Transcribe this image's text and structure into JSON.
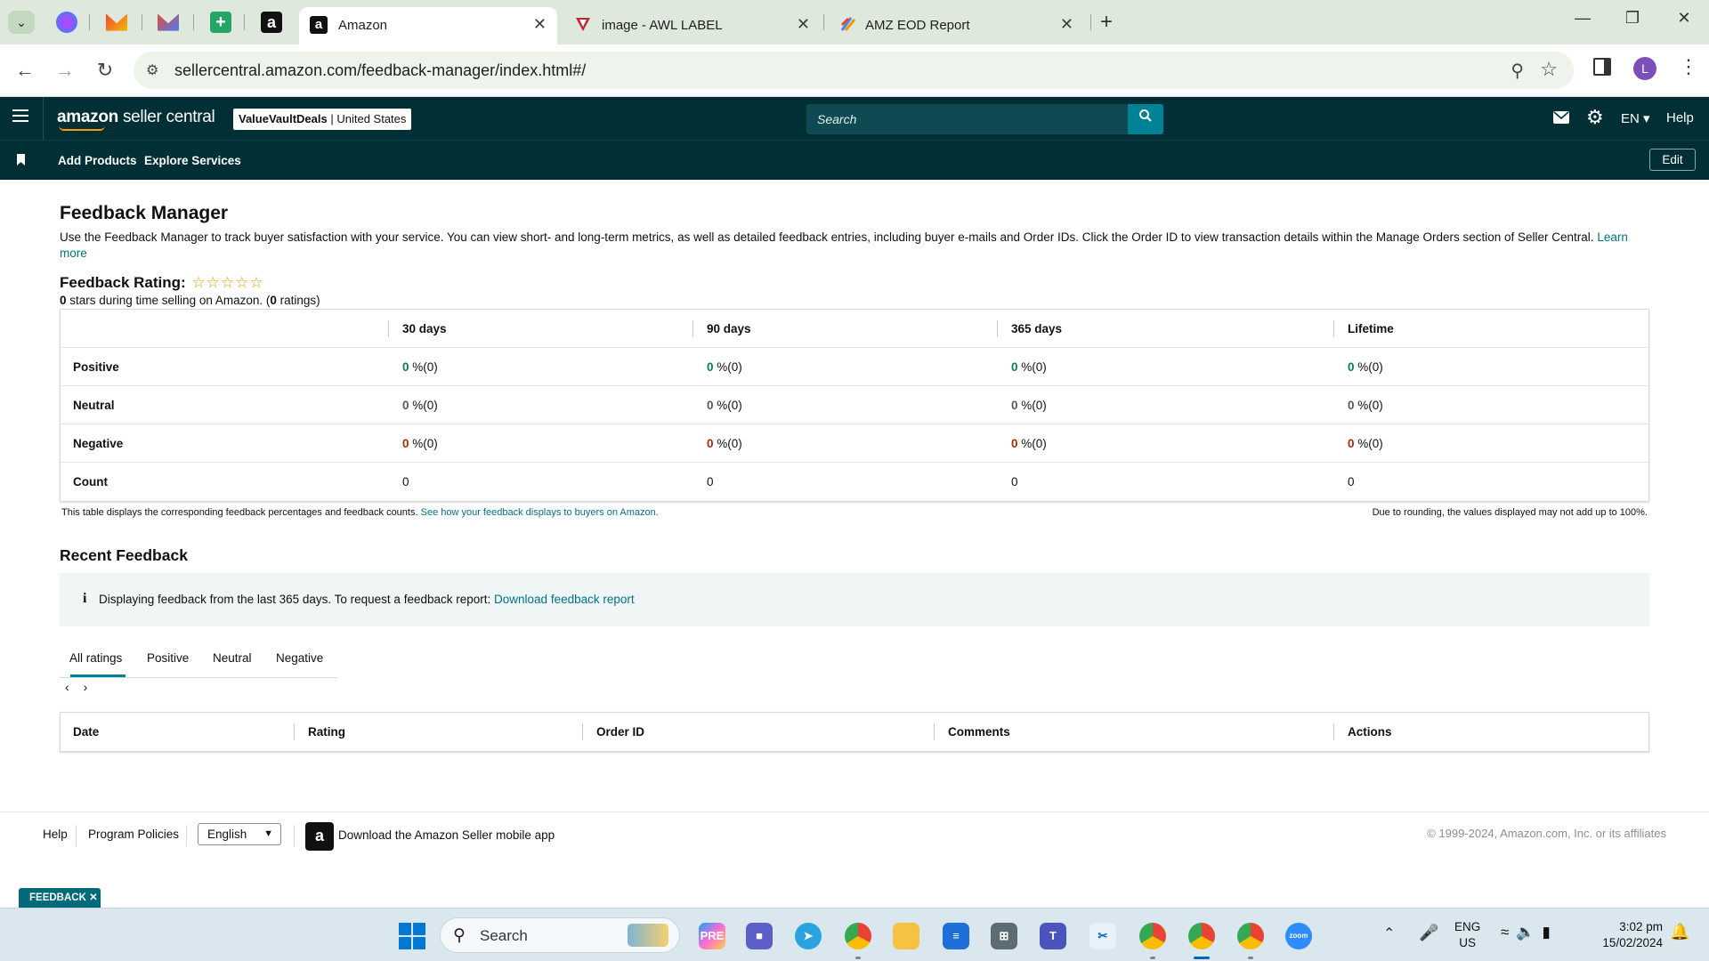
{
  "browser": {
    "tabs": [
      {
        "title": "Amazon",
        "icon": "amazon-favicon",
        "active": true
      },
      {
        "title": "image - AWL LABEL",
        "icon": "awl-favicon",
        "active": false
      },
      {
        "title": "AMZ EOD Report",
        "icon": "report-favicon",
        "active": false
      }
    ],
    "url": "sellercentral.amazon.com/feedback-manager/index.html#/",
    "profile_initial": "L"
  },
  "header": {
    "logo_bold": "amazon",
    "logo_light": "seller central",
    "store_name": "ValueVaultDeals",
    "store_region": "United States",
    "search_placeholder": "Search",
    "language": "EN",
    "help": "Help"
  },
  "subnav": {
    "links": [
      "Add Products",
      "Explore Services"
    ],
    "edit": "Edit"
  },
  "page": {
    "title": "Feedback Manager",
    "intro": "Use the Feedback Manager to track buyer satisfaction with your service. You can view short- and long-term metrics, as well as detailed feedback entries, including buyer e-mails and Order IDs. Click the Order ID to view transaction details within the Manage Orders section of Seller Central.",
    "learn_more": "Learn more",
    "rating_label": "Feedback Rating:",
    "rating_stars": 0,
    "rating_sub_stars": "0",
    "rating_sub_middle": " stars during time selling on Amazon. (",
    "rating_sub_count": "0",
    "rating_sub_end": " ratings)"
  },
  "feedback_table": {
    "columns": [
      "30 days",
      "90 days",
      "365 days",
      "Lifetime"
    ],
    "rows": [
      {
        "label": "Positive",
        "value": "0",
        "rest": " %(0)",
        "tone": "green"
      },
      {
        "label": "Neutral",
        "value": "0",
        "rest": " %(0)",
        "tone": "grey"
      },
      {
        "label": "Negative",
        "value": "0",
        "rest": " %(0)",
        "tone": "red"
      },
      {
        "label": "Count",
        "value": "0",
        "rest": "",
        "tone": "count"
      }
    ],
    "note": "This table displays the corresponding feedback percentages and feedback counts.",
    "note_link": "See how your feedback displays to buyers on Amazon.",
    "rounding_note": "Due to rounding, the values displayed may not add up to 100%."
  },
  "recent": {
    "title": "Recent Feedback",
    "info_text": "Displaying feedback from the last 365 days. To request a feedback report:",
    "info_link": "Download feedback report",
    "tabs": [
      "All ratings",
      "Positive",
      "Neutral",
      "Negative"
    ],
    "active_tab": "All ratings",
    "columns": [
      "Date",
      "Rating",
      "Order ID",
      "Comments",
      "Actions"
    ]
  },
  "footer": {
    "links": [
      "Help",
      "Program Policies"
    ],
    "language": "English",
    "app_text": "Download the Amazon Seller mobile app",
    "copyright": "© 1999-2024, Amazon.com, Inc. or its affiliates",
    "feedback_button": "FEEDBACK"
  },
  "taskbar": {
    "search": "Search",
    "lang_line1": "ENG",
    "lang_line2": "US",
    "time": "3:02 pm",
    "date": "15/02/2024"
  },
  "colors": {
    "header_bg": "#002f36",
    "accent_teal": "#008296",
    "positive": "#067d62",
    "negative": "#b12704",
    "star": "#e7a100"
  }
}
